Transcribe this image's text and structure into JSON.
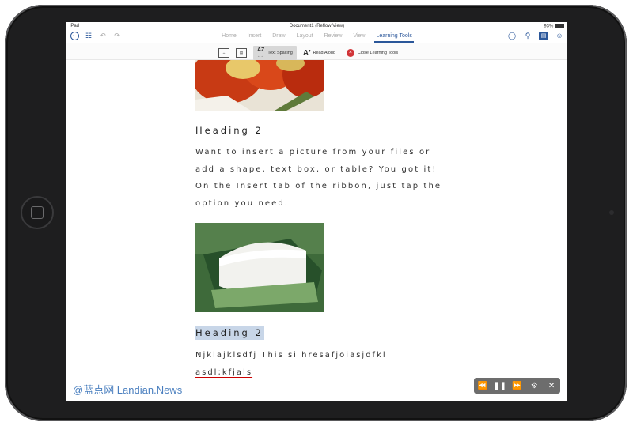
{
  "status": {
    "device": "iPad",
    "doc_title": "Document1 (Reflow View)",
    "battery": "93%"
  },
  "tabs": [
    {
      "label": "Home"
    },
    {
      "label": "Insert"
    },
    {
      "label": "Draw"
    },
    {
      "label": "Layout"
    },
    {
      "label": "Review"
    },
    {
      "label": "View"
    },
    {
      "label": "Learning Tools"
    }
  ],
  "ribbon": {
    "text_spacing": "Text Spacing",
    "az": "AZ",
    "read_aloud": "Read Aloud",
    "close_learning_tools": "Close Learning Tools"
  },
  "document": {
    "heading_1": "Heading 2",
    "paragraph": "Want to insert a picture from your files or add a shape, text box, or table? You got it! On the Insert tab of the ribbon, just tap the option you need.",
    "heading_2": "Heading 2",
    "last_word_1": "Njklajklsdfj",
    "last_word_2": "This si",
    "last_word_3": "hresafjoiasjdfkl",
    "last_word_4": "asdl;kfjals"
  },
  "watermark": "@蓝点网 Landian.News",
  "icons": {
    "back": "back-arrow-icon",
    "file": "file-icon",
    "undo": "undo-icon",
    "redo": "redo-icon",
    "lightbulb": "lightbulb-icon",
    "search": "search-icon",
    "share": "share-icon",
    "add_person": "add-person-icon"
  }
}
